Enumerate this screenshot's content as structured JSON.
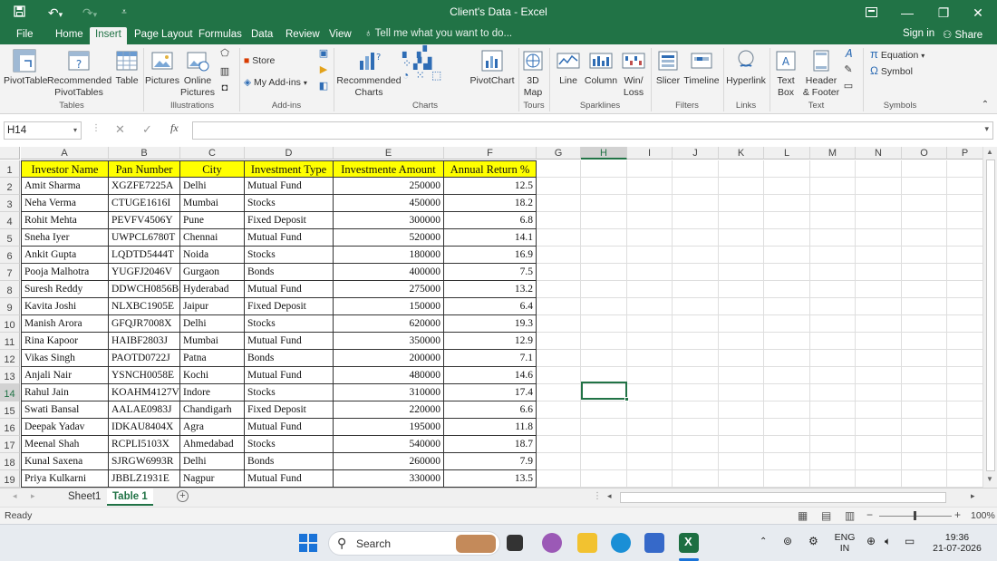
{
  "window": {
    "title": "Client's Data  -  Excel",
    "colors": {
      "brand": "#217346",
      "header_fill": "#ffff00"
    }
  },
  "menu": {
    "tabs": [
      "File",
      "Home",
      "Insert",
      "Page Layout",
      "Formulas",
      "Data",
      "Review",
      "View"
    ],
    "active_tab": "Insert",
    "tell_me": "Tell me what you want to do...",
    "sign_in": "Sign in",
    "share": "Share"
  },
  "ribbon": {
    "pivot_table": "PivotTable",
    "recommended_pivot_1": "Recommended",
    "recommended_pivot_2": "PivotTables",
    "table": "Table",
    "tables_group": "Tables",
    "pictures": "Pictures",
    "online_1": "Online",
    "online_2": "Pictures",
    "illustrations_group": "Illustrations",
    "store": "Store",
    "my_addins": "My Add-ins",
    "addins_group": "Add-ins",
    "rec_charts_1": "Recommended",
    "rec_charts_2": "Charts",
    "pivot_chart": "PivotChart",
    "charts_group": "Charts",
    "map_1": "3D",
    "map_2": "Map",
    "tours_group": "Tours",
    "line": "Line",
    "column": "Column",
    "winloss_1": "Win/",
    "winloss_2": "Loss",
    "sparklines_group": "Sparklines",
    "slicer": "Slicer",
    "timeline": "Timeline",
    "filters_group": "Filters",
    "hyperlink": "Hyperlink",
    "links_group": "Links",
    "textbox_1": "Text",
    "textbox_2": "Box",
    "header_1": "Header",
    "header_2": "& Footer",
    "text_group": "Text",
    "equation": "Equation",
    "symbol": "Symbol",
    "symbols_group": "Symbols"
  },
  "formula_bar": {
    "name_box": "H14",
    "fx": "fx",
    "value": ""
  },
  "columns": [
    "A",
    "B",
    "C",
    "D",
    "E",
    "F",
    "G",
    "H",
    "I",
    "J",
    "K",
    "L",
    "M",
    "N",
    "O",
    "P"
  ],
  "selected_column": "H",
  "selected_row": "14",
  "headers": [
    "Investor Name",
    "Pan Number",
    "City",
    "Investment Type",
    "Investmente Amount",
    "Annual Return %"
  ],
  "rows": [
    [
      "Amit Sharma",
      "XGZFE7225A",
      "Delhi",
      "Mutual Fund",
      "250000",
      "12.5"
    ],
    [
      "Neha Verma",
      "CTUGE1616I",
      "Mumbai",
      "Stocks",
      "450000",
      "18.2"
    ],
    [
      "Rohit Mehta",
      "PEVFV4506Y",
      "Pune",
      "Fixed Deposit",
      "300000",
      "6.8"
    ],
    [
      "Sneha Iyer",
      "UWPCL6780T",
      "Chennai",
      "Mutual Fund",
      "520000",
      "14.1"
    ],
    [
      "Ankit Gupta",
      "LQDTD5444T",
      "Noida",
      "Stocks",
      "180000",
      "16.9"
    ],
    [
      "Pooja Malhotra",
      "YUGFJ2046V",
      "Gurgaon",
      "Bonds",
      "400000",
      "7.5"
    ],
    [
      "Suresh Reddy",
      "DDWCH0856B",
      "Hyderabad",
      "Mutual Fund",
      "275000",
      "13.2"
    ],
    [
      "Kavita Joshi",
      "NLXBC1905E",
      "Jaipur",
      "Fixed Deposit",
      "150000",
      "6.4"
    ],
    [
      "Manish Arora",
      "GFQJR7008X",
      "Delhi",
      "Stocks",
      "620000",
      "19.3"
    ],
    [
      "Rina Kapoor",
      "HAIBF2803J",
      "Mumbai",
      "Mutual Fund",
      "350000",
      "12.9"
    ],
    [
      "Vikas Singh",
      "PAOTD0722J",
      "Patna",
      "Bonds",
      "200000",
      "7.1"
    ],
    [
      "Anjali Nair",
      "YSNCH0058E",
      "Kochi",
      "Mutual Fund",
      "480000",
      "14.6"
    ],
    [
      "Rahul Jain",
      "KOAHM4127V",
      "Indore",
      "Stocks",
      "310000",
      "17.4"
    ],
    [
      "Swati Bansal",
      "AALAE0983J",
      "Chandigarh",
      "Fixed Deposit",
      "220000",
      "6.6"
    ],
    [
      "Deepak Yadav",
      "IDKAU8404X",
      "Agra",
      "Mutual Fund",
      "195000",
      "11.8"
    ],
    [
      "Meenal Shah",
      "RCPLI5103X",
      "Ahmedabad",
      "Stocks",
      "540000",
      "18.7"
    ],
    [
      "Kunal Saxena",
      "SJRGW6993R",
      "Delhi",
      "Bonds",
      "260000",
      "7.9"
    ],
    [
      "Priya Kulkarni",
      "JBBLZ1931E",
      "Nagpur",
      "Mutual Fund",
      "330000",
      "13.5"
    ]
  ],
  "row_numbers": [
    "1",
    "2",
    "3",
    "4",
    "5",
    "6",
    "7",
    "8",
    "9",
    "10",
    "11",
    "12",
    "13",
    "14",
    "15",
    "16",
    "17",
    "18",
    "19"
  ],
  "sheets": [
    "Sheet1",
    "Table 1"
  ],
  "active_sheet": "Table 1",
  "status": {
    "ready": "Ready",
    "zoom": "100%"
  },
  "taskbar": {
    "search": "Search",
    "lang_1": "ENG",
    "lang_2": "IN",
    "time": "19:36",
    "date": "21-07-2026"
  }
}
